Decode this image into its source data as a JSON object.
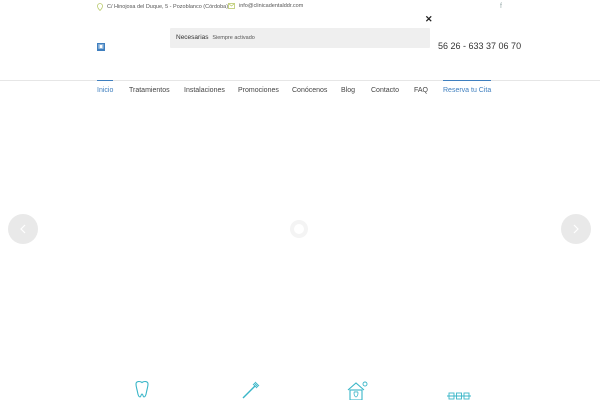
{
  "topbar": {
    "address": "C/ Hinojosa del Duque, 5 - Pozoblanco (Córdoba)",
    "email": "info@clinicadentalddr.com",
    "social_icon": "facebook-icon"
  },
  "header": {
    "logo_icon": "clinic-logo-icon",
    "phone": "56 26 - 633 37 06 70"
  },
  "cookie_popup": {
    "category": "Necesarias",
    "status": "Siempre activado",
    "close_icon": "close-icon"
  },
  "nav": {
    "items": [
      "Inicio",
      "Tratamientos",
      "Instalaciones",
      "Promociones",
      "Conócenos",
      "Blog",
      "Contacto",
      "FAQ",
      "Reserva tu Cita"
    ],
    "active": "Inicio"
  },
  "slider": {
    "prev_icon": "chevron-left-icon",
    "next_icon": "chevron-right-icon",
    "loader_icon": "loading-spinner-icon"
  },
  "services": {
    "icons": [
      "tooth-icon",
      "toothbrush-icon",
      "dental-clinic-icon",
      "braces-icon"
    ]
  },
  "colors": {
    "accent": "#3f7fbf",
    "icon_teal": "#3ab6c8",
    "topbar_icon": "#b9c96b"
  }
}
